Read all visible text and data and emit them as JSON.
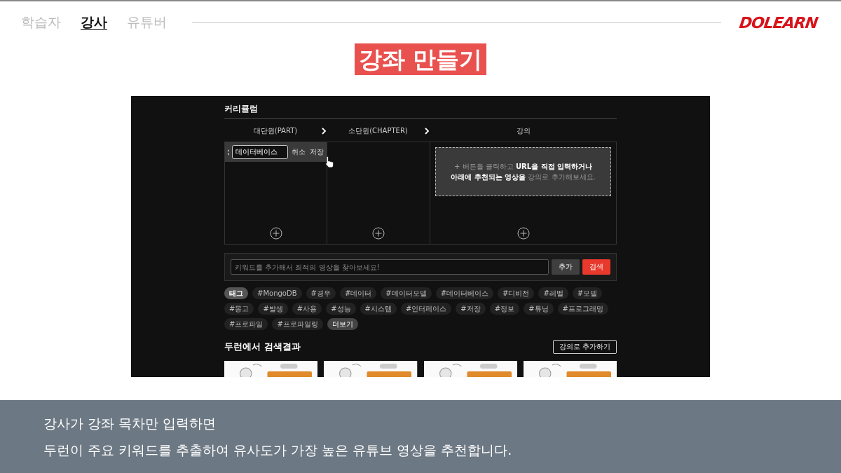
{
  "nav": {
    "tabs": [
      {
        "label": "학습자",
        "selected": false
      },
      {
        "label": "강사",
        "selected": true
      },
      {
        "label": "유튜버",
        "selected": false
      }
    ],
    "logo": "DOLEARN"
  },
  "title": "강좌 만들기",
  "app": {
    "section_title": "커리큘럼",
    "columns": [
      "대단원(PART)",
      "소단원(CHAPTER)",
      "강의"
    ],
    "part_editor": {
      "value": "데이터베이스",
      "cancel": "취소",
      "save": "저장"
    },
    "hint": [
      "+ 버튼을 클릭하고 **URL을 직접 입력하거나**",
      "**아래에 추천되는 영상을** 강의로 추가해보세요."
    ],
    "search": {
      "placeholder": "키워드를 추가해서 최적의 영상을 찾아보세요!",
      "add": "추가",
      "search": "검색"
    },
    "tags": [
      {
        "label": "태그",
        "kind": "header"
      },
      {
        "label": "#MongoDB",
        "kind": "tag"
      },
      {
        "label": "#경우",
        "kind": "tag"
      },
      {
        "label": "#데이터",
        "kind": "tag"
      },
      {
        "label": "#데이터모델",
        "kind": "tag"
      },
      {
        "label": "#데이터베이스",
        "kind": "tag"
      },
      {
        "label": "#디비전",
        "kind": "tag"
      },
      {
        "label": "#레벨",
        "kind": "tag"
      },
      {
        "label": "#모델",
        "kind": "tag"
      },
      {
        "label": "#몽고",
        "kind": "tag"
      },
      {
        "label": "#발생",
        "kind": "tag"
      },
      {
        "label": "#사용",
        "kind": "tag"
      },
      {
        "label": "#성능",
        "kind": "tag"
      },
      {
        "label": "#시스템",
        "kind": "tag"
      },
      {
        "label": "#인터페이스",
        "kind": "tag"
      },
      {
        "label": "#저장",
        "kind": "tag"
      },
      {
        "label": "#정보",
        "kind": "tag"
      },
      {
        "label": "#튜닝",
        "kind": "tag"
      },
      {
        "label": "#프로그래밍",
        "kind": "tag"
      },
      {
        "label": "#프로파일",
        "kind": "tag"
      },
      {
        "label": "#프로파일링",
        "kind": "tag"
      },
      {
        "label": "더보기",
        "kind": "more"
      }
    ],
    "results": {
      "title": "두런에서 검색결과",
      "add_button": "강의로 추가하기"
    }
  },
  "captions": [
    "강사가 강좌 목차만 입력하면",
    "두런이 주요 키워드를 추출하여 유사도가 가장 높은 유튜브 영상을 추천합니다."
  ]
}
